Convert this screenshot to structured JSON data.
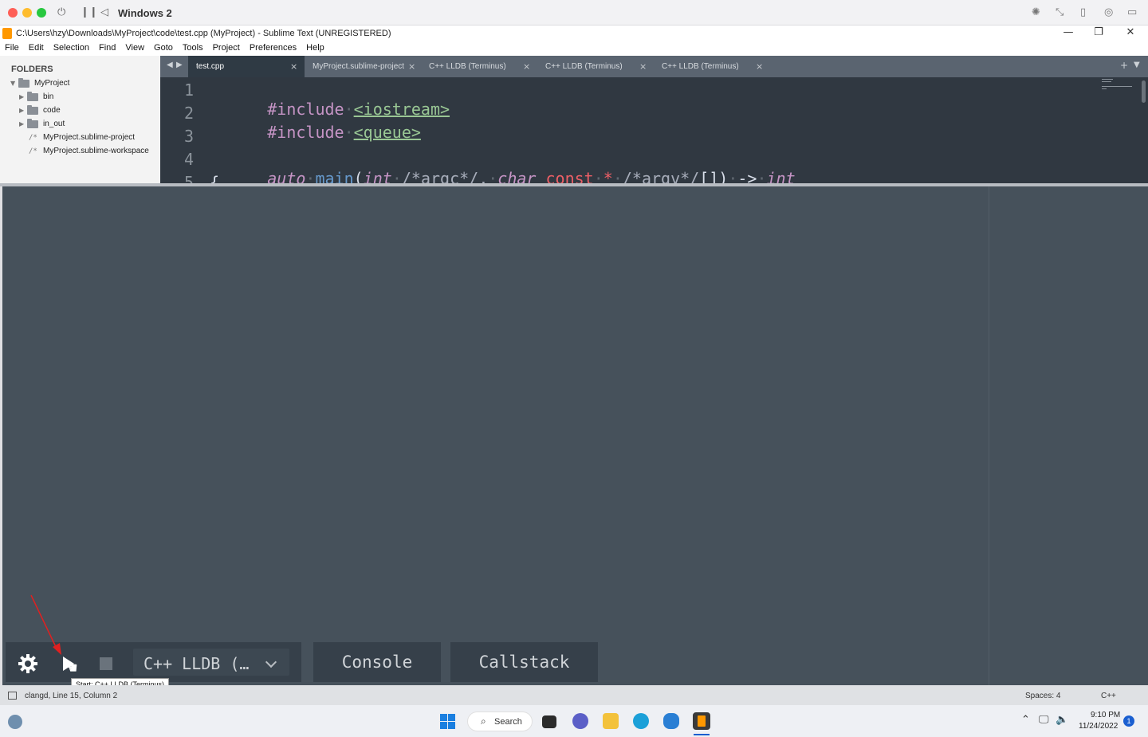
{
  "host": {
    "title": "Windows 2"
  },
  "window": {
    "title": "C:\\Users\\hzy\\Downloads\\MyProject\\code\\test.cpp (MyProject) - Sublime Text (UNREGISTERED)",
    "minimize": "—",
    "maximize": "❐",
    "close": "✕"
  },
  "menu": {
    "items": [
      "File",
      "Edit",
      "Selection",
      "Find",
      "View",
      "Goto",
      "Tools",
      "Project",
      "Preferences",
      "Help"
    ]
  },
  "sidebar": {
    "heading": "FOLDERS",
    "root": "MyProject",
    "folders": [
      "bin",
      "code",
      "in_out"
    ],
    "files": [
      "MyProject.sublime-project",
      "MyProject.sublime-workspace"
    ],
    "file_prefix": "/*"
  },
  "tabs": [
    {
      "label": "test.cpp",
      "active": true
    },
    {
      "label": "MyProject.sublime-project",
      "active": false
    },
    {
      "label": "C++ LLDB (Terminus)",
      "active": false
    },
    {
      "label": "C++ LLDB (Terminus)",
      "active": false
    },
    {
      "label": "C++ LLDB (Terminus)",
      "active": false
    }
  ],
  "editor": {
    "line_numbers": [
      "1",
      "2",
      "3",
      "4",
      "5"
    ],
    "line1": {
      "directive": "#include",
      "header": "<iostream>"
    },
    "line2": {
      "directive": "#include",
      "header": "<queue>"
    },
    "line4": {
      "auto": "auto",
      "main": "main",
      "open": "(",
      "int1": "int",
      "cm1": "/*argc*/,",
      "char": "char",
      "const": "const",
      "star": "*",
      "cm2": "/*argv*/",
      "brackets": "[])",
      "arrow": "->",
      "int2": "int"
    },
    "line5": "{"
  },
  "debugger": {
    "target_label": "C++ LLDB (…",
    "console_label": "Console",
    "callstack_label": "Callstack",
    "tooltip": "Start: C++ LLDB (Terminus)",
    "icons": [
      "gear-icon",
      "play-icon",
      "stop-icon",
      "chevron-down-icon"
    ]
  },
  "status": {
    "left": "clangd, Line 15, Column 2",
    "spaces": "Spaces: 4",
    "syntax": "C++"
  },
  "taskbar": {
    "search_label": "Search",
    "time": "9:10 PM",
    "date": "11/24/2022",
    "notifications": "1"
  }
}
